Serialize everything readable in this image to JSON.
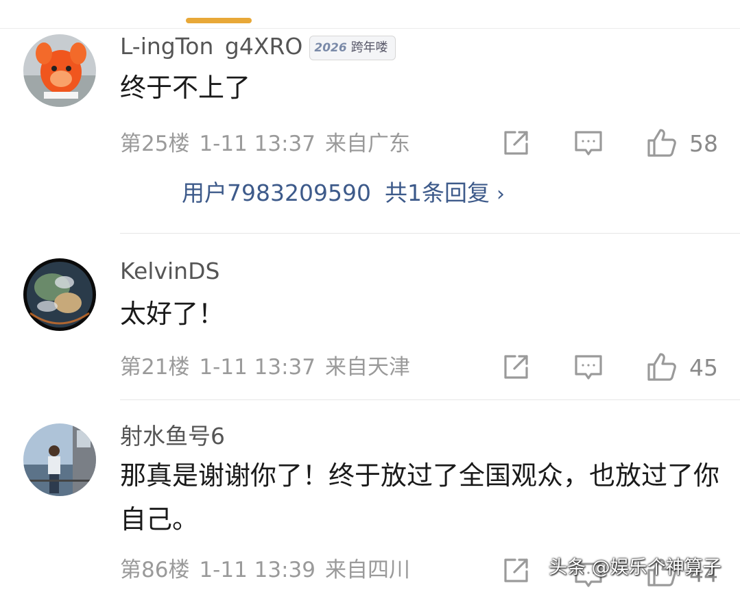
{
  "comments": [
    {
      "username": "L-ingTon g4XRO",
      "badge_year": "2026",
      "badge_text": "跨年喽",
      "text": "终于不上了",
      "floor": "第25楼",
      "date": "1-11 13:37",
      "location": "来自广东",
      "likes": "58",
      "reply_user": "用户7983209590",
      "reply_count": "共1条回复"
    },
    {
      "username": "KelvinDS",
      "text": "太好了！",
      "floor": "第21楼",
      "date": "1-11 13:37",
      "location": "来自天津",
      "likes": "45"
    },
    {
      "username": "射水鱼号6",
      "text": "那真是谢谢你了！终于放过了全国观众，也放过了你自己。",
      "floor": "第86楼",
      "date": "1-11 13:39",
      "location": "来自四川",
      "likes": "44"
    }
  ],
  "watermark": "头条 @娱乐个神算子",
  "colors": {
    "accent": "#e8a838",
    "link": "#3d5a8a",
    "meta": "#9a9a9a"
  },
  "icons": [
    "share-icon",
    "comment-icon",
    "thumbs-up-icon",
    "chevron-right-icon"
  ]
}
